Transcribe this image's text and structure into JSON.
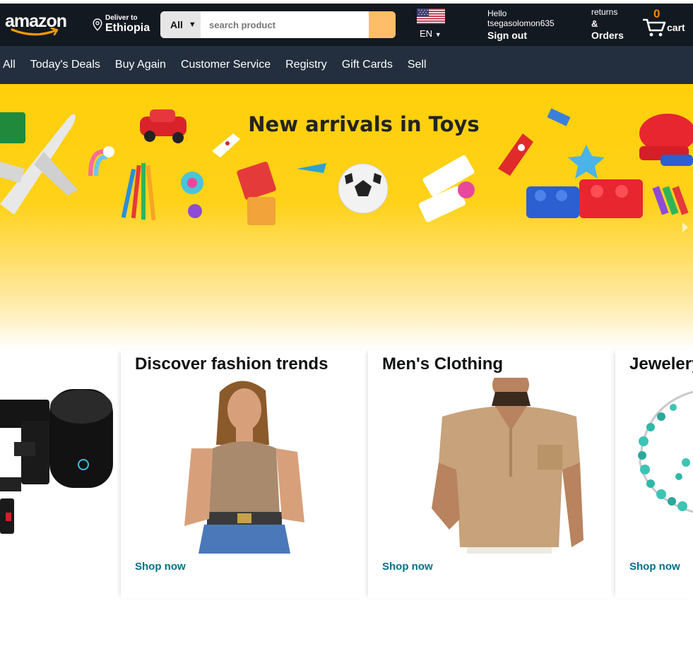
{
  "header": {
    "logo_text": "amazon",
    "deliver_small": "Deliver to",
    "deliver_location": "Ethiopia",
    "search_category": "All",
    "search_placeholder": "search product",
    "language": "EN",
    "account_greeting": "Hello",
    "account_username": "tsegasolomon635",
    "account_action": "Sign out",
    "returns_line1": "returns",
    "returns_line2": "&",
    "returns_line3": "Orders",
    "cart_count": "0",
    "cart_label": "cart"
  },
  "nav": {
    "items": [
      "All",
      "Today's Deals",
      "Buy Again",
      "Customer Service",
      "Registry",
      "Gift Cards",
      "Sell"
    ]
  },
  "hero": {
    "title": "New arrivals in Toys"
  },
  "cards": [
    {
      "title": "",
      "link": ""
    },
    {
      "title": "Discover fashion trends",
      "link": "Shop now"
    },
    {
      "title": "Men's Clothing",
      "link": "Shop now"
    },
    {
      "title": "Jewelery",
      "link": "Shop now"
    }
  ],
  "colors": {
    "header_bg": "#131921",
    "nav_bg": "#232f3e",
    "search_button": "#febd69",
    "cart_count": "#f08804",
    "link": "#007185",
    "hero_yellow": "#ffcf0a"
  }
}
